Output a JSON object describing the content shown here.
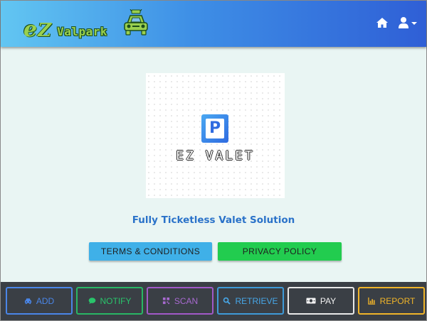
{
  "header": {
    "brand_e": "e",
    "brand_z": "Z",
    "brand_name": "Valpark",
    "home_icon": "home-icon",
    "user_icon": "user-dropdown-icon"
  },
  "logo": {
    "badge_letter": "P",
    "text": "EZ VALET"
  },
  "main": {
    "tagline": "Fully Ticketless Valet Solution",
    "terms_label": "TERMS & CONDITIONS",
    "privacy_label": "PRIVACY POLICY"
  },
  "footer": {
    "buttons": [
      {
        "label": "ADD",
        "icon": "car-icon",
        "color": "#4a86e8"
      },
      {
        "label": "NOTIFY",
        "icon": "chat-icon",
        "color": "#29b765"
      },
      {
        "label": "SCAN",
        "icon": "qrcode-icon",
        "color": "#a159c8"
      },
      {
        "label": "RETRIEVE",
        "icon": "search-icon",
        "color": "#3f9ad8"
      },
      {
        "label": "PAY",
        "icon": "money-icon",
        "color": "#e8e8e8"
      },
      {
        "label": "REPORT",
        "icon": "chart-icon",
        "color": "#f0b429"
      }
    ]
  },
  "colors": {
    "header_start": "#62c6f2",
    "header_end": "#2f5fd6",
    "background": "#e9f5f3",
    "footer": "#3a3f45",
    "terms_button": "#3fb0e8",
    "privacy_button": "#22cc4f",
    "tagline": "#2a72c9"
  }
}
